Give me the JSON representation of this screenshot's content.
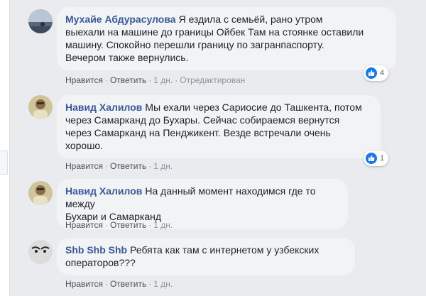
{
  "comments": [
    {
      "author": "Мухайе Абдурасулова",
      "lines": [
        "Я ездила с семьёй, рано утром",
        "выехали на машине до границы Ойбек Там на стоянке оставили",
        "машину. Спокойно перешли границу по загранпаспорту.",
        "Вечером также вернулись."
      ],
      "like_label": "Нравится",
      "reply_label": "Ответить",
      "time": "1 дн.",
      "edited_label": "Отредактирован",
      "reaction_count": "4"
    },
    {
      "author": "Навид Халилов",
      "lines": [
        "Мы ехали через Сариосие до Ташкента, потом",
        "через Самарканд до Бухары. Сейчас собираемся вернутся",
        "через Самарканд на Пенджикент. Везде встречали очень",
        "хорошо."
      ],
      "like_label": "Нравится",
      "reply_label": "Ответить",
      "time": "1 дн.",
      "reaction_count": "1"
    },
    {
      "author": "Навид Халилов",
      "lines": [
        "На данный момент находимся где то между",
        "Бухари и Самарканд"
      ],
      "like_label": "Нравится",
      "reply_label": "Ответить",
      "time": "1 дн."
    },
    {
      "author": "Shb Shb Shb",
      "lines": [
        "Ребята как там с интернетом у узбекских",
        "операторов???"
      ],
      "like_label": "Нравится",
      "reply_label": "Ответить",
      "time": "1 дн."
    }
  ],
  "colors": {
    "author": "#385898",
    "bubble": "#f2f3f5",
    "page_bg": "#e9ebee",
    "like_blue": "#1877f2"
  },
  "icons": [
    "avatar-photo",
    "like-thumb-icon"
  ]
}
